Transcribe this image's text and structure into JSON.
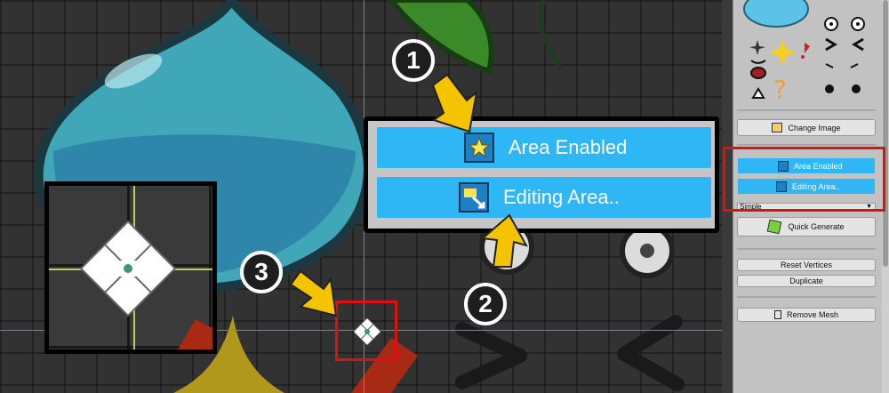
{
  "callout": {
    "area_enabled_label": "Area Enabled",
    "editing_area_label": "Editing Area.."
  },
  "badges": [
    "1",
    "2",
    "3"
  ],
  "panel": {
    "change_image_label": "Change Image",
    "area_enabled_label": "Area Enabled",
    "editing_area_label": "Editing Area..",
    "mode_select_value": "Simple",
    "quick_generate_label": "Quick Generate",
    "reset_vertices_label": "Reset Vertices",
    "duplicate_label": "Duplicate",
    "remove_mesh_label": "Remove Mesh"
  },
  "colors": {
    "accent_blue": "#2eb6f5",
    "highlight_red": "#e01010",
    "arrow_yellow": "#f5c400"
  },
  "icons": [
    "star-icon",
    "edit-area-icon",
    "change-image-icon",
    "quick-generate-icon",
    "trash-icon",
    "move-handle-icon"
  ]
}
